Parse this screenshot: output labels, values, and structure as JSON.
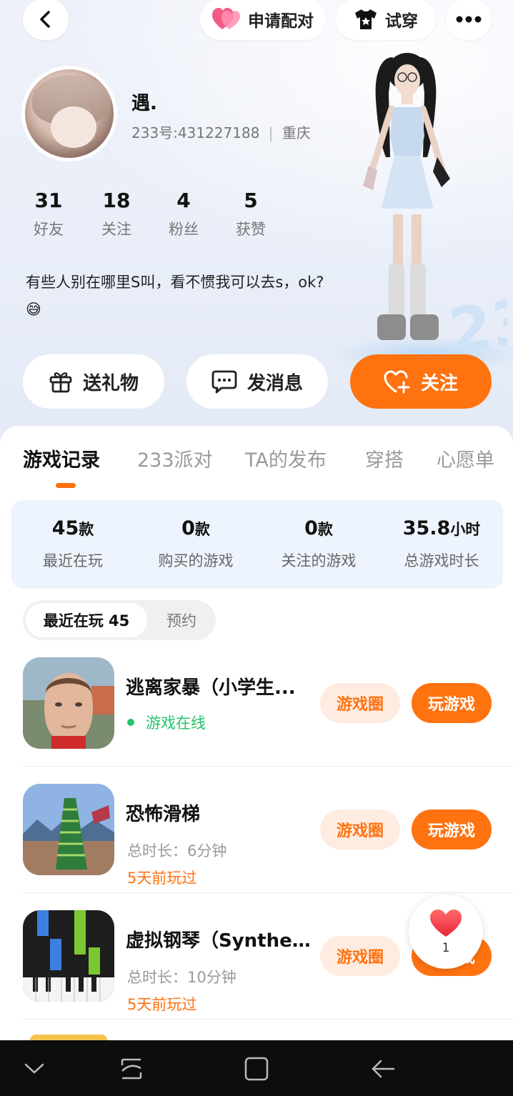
{
  "header": {
    "pair_label": "申请配对",
    "tryon_label": "试穿"
  },
  "profile": {
    "name": "遇.",
    "uid_line": "233号:431227188",
    "location": "重庆",
    "stats": [
      {
        "num": "31",
        "label": "好友"
      },
      {
        "num": "18",
        "label": "关注"
      },
      {
        "num": "4",
        "label": "粉丝"
      },
      {
        "num": "5",
        "label": "获赞"
      }
    ],
    "bio": "有些人别在哪里S叫，看不惯我可以去s，ok? 😅"
  },
  "actions": {
    "gift": "送礼物",
    "message": "发消息",
    "follow": "关注"
  },
  "tabs": [
    "游戏记录",
    "233派对",
    "TA的发布",
    "穿搭",
    "心愿单"
  ],
  "summary": [
    {
      "value": "45",
      "unit": "款",
      "label": "最近在玩"
    },
    {
      "value": "0",
      "unit": "款",
      "label": "购买的游戏"
    },
    {
      "value": "0",
      "unit": "款",
      "label": "关注的游戏"
    },
    {
      "value": "35.8",
      "unit": "小时",
      "label": "总游戏时长"
    }
  ],
  "segments": {
    "recent": "最近在玩 45",
    "reserve": "预约"
  },
  "games": [
    {
      "title": "逃离家暴（小学生...",
      "status": "游戏在线",
      "circle": "游戏圈",
      "play": "玩游戏"
    },
    {
      "title": "恐怖滑梯",
      "duration": "总时长：6分钟",
      "last": "5天前玩过",
      "circle": "游戏圈",
      "play": "玩游戏"
    },
    {
      "title": "虚拟钢琴（Synthesi...",
      "duration": "总时长：10分钟",
      "last": "5天前玩过",
      "circle": "游戏圈",
      "play": "玩游戏"
    }
  ],
  "like_float": {
    "count": "1"
  },
  "colors": {
    "accent": "#ff7210",
    "online": "#22c46a",
    "summary_bg": "#eef4fd"
  }
}
